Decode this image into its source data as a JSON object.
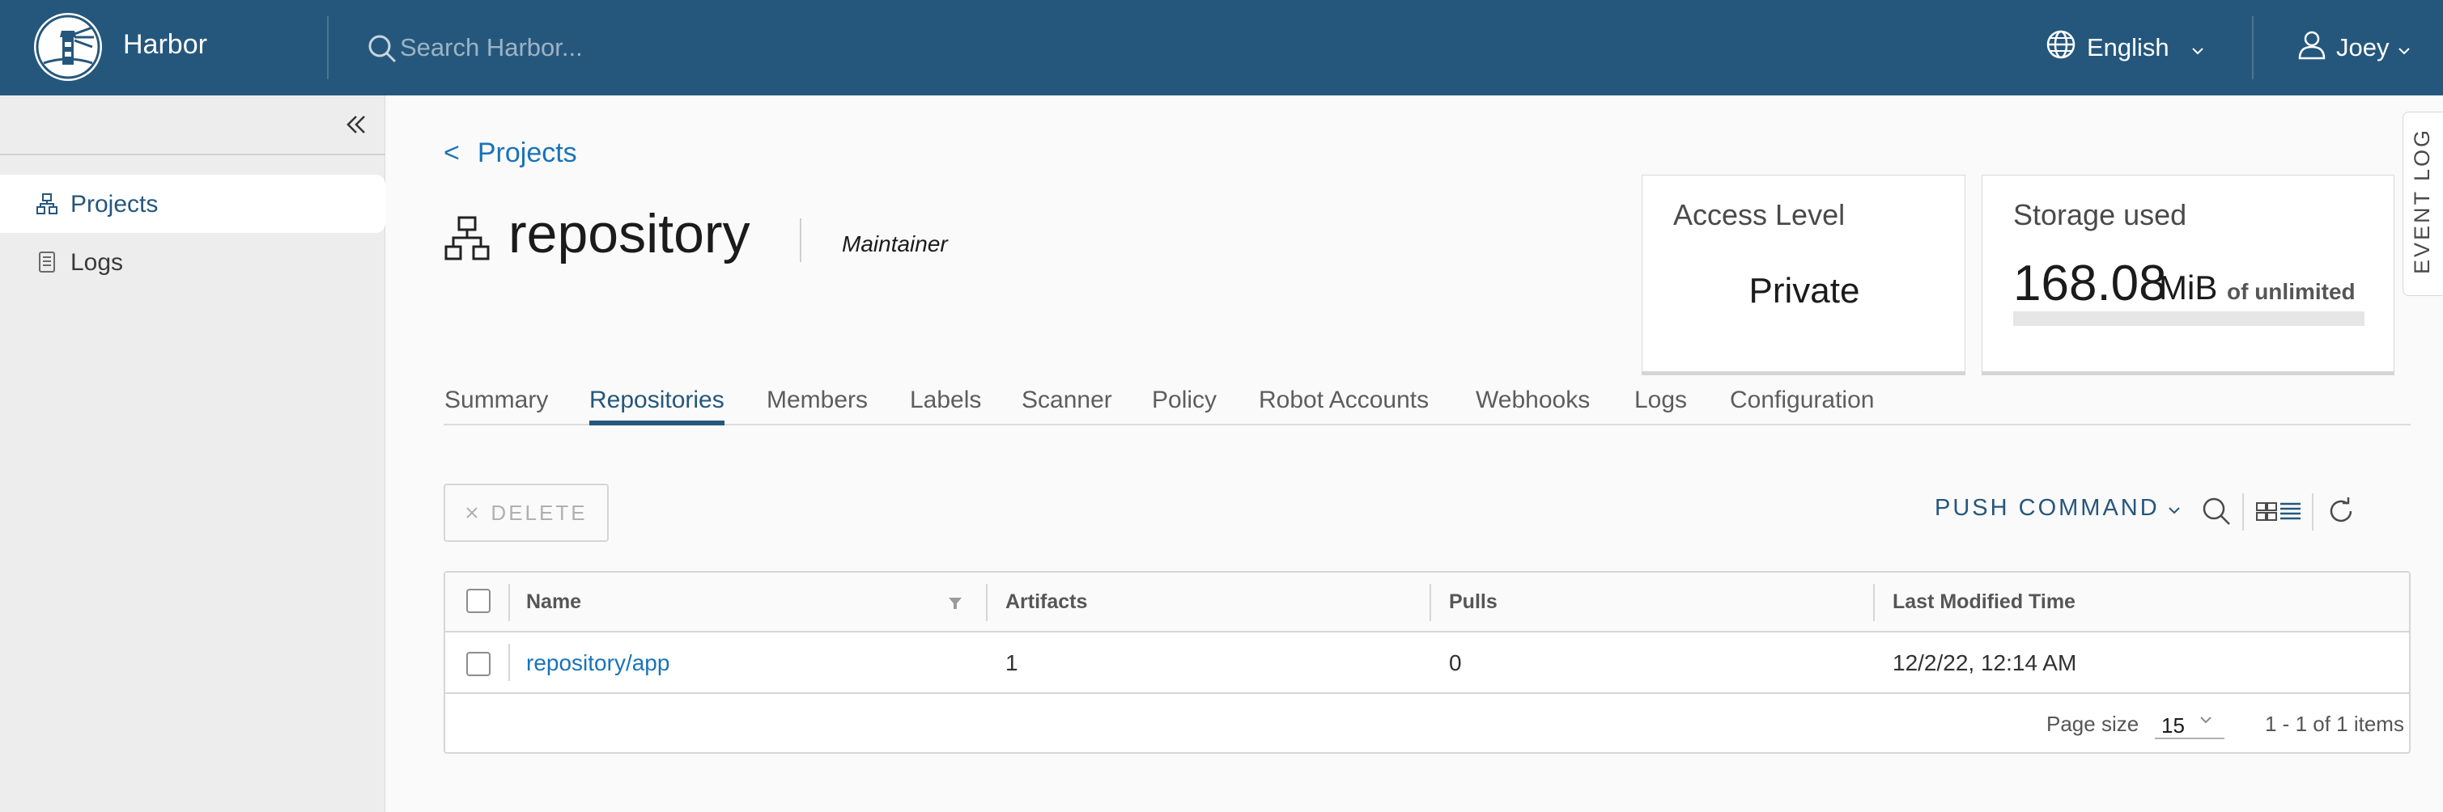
{
  "header": {
    "app_title": "Harbor",
    "search_placeholder": "Search Harbor...",
    "language": "English",
    "user": "Joey"
  },
  "sidebar": {
    "items": [
      {
        "label": "Projects",
        "icon": "projects-icon",
        "active": true
      },
      {
        "label": "Logs",
        "icon": "logs-icon",
        "active": false
      }
    ]
  },
  "breadcrumb": {
    "back_arrow": "<",
    "label": "Projects"
  },
  "project": {
    "name": "repository",
    "role": "Maintainer"
  },
  "cards": {
    "access": {
      "title": "Access Level",
      "value": "Private"
    },
    "storage": {
      "title": "Storage used",
      "amount": "168.08",
      "unit": "MiB",
      "limit": "of unlimited",
      "fill": 0
    }
  },
  "event_log": "EVENT LOG",
  "tabs": [
    "Summary",
    "Repositories",
    "Members",
    "Labels",
    "Scanner",
    "Policy",
    "Robot Accounts",
    "Webhooks",
    "Logs",
    "Configuration"
  ],
  "active_tab": "Repositories",
  "toolbar": {
    "delete_label": "DELETE",
    "push_command_label": "PUSH COMMAND"
  },
  "table": {
    "columns": [
      "Name",
      "Artifacts",
      "Pulls",
      "Last Modified Time"
    ],
    "rows": [
      {
        "name": "repository/app",
        "artifacts": "1",
        "pulls": "0",
        "modified": "12/2/22, 12:14 AM"
      }
    ],
    "footer": {
      "page_size_label": "Page size",
      "page_size": "15",
      "range": "1 - 1 of 1 items"
    }
  },
  "colors": {
    "header_bg": "#25577c",
    "link": "#1a73b8",
    "accent": "#25577c"
  }
}
